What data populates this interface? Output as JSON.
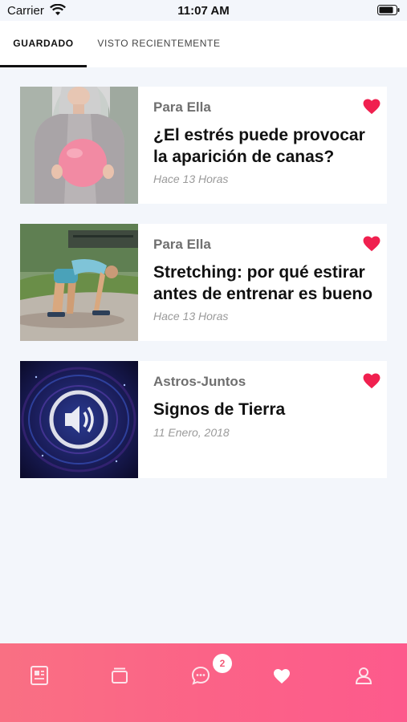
{
  "status_bar": {
    "carrier": "Carrier",
    "time": "11:07 AM"
  },
  "tabs": [
    {
      "label": "GUARDADO",
      "active": true
    },
    {
      "label": "VISTO RECIENTEMENTE",
      "active": false
    }
  ],
  "articles": [
    {
      "category": "Para Ella",
      "title": "¿El estrés puede provocar la aparición de canas?",
      "time": "Hace 13 Horas",
      "favorited": true
    },
    {
      "category": "Para Ella",
      "title": "Stretching: por qué estirar antes de entrenar es bueno",
      "time": "Hace 13 Horas",
      "favorited": true
    },
    {
      "category": "Astros-Juntos",
      "title": "Signos de Tierra",
      "time": "11 Enero, 2018",
      "favorited": true
    }
  ],
  "tabbar": {
    "items": [
      {
        "icon": "newspaper-icon"
      },
      {
        "icon": "cards-icon"
      },
      {
        "icon": "chat-icon",
        "badge": "2"
      },
      {
        "icon": "heart-icon",
        "active": true
      },
      {
        "icon": "user-icon"
      }
    ]
  },
  "colors": {
    "accent": "#f0204f",
    "tabbar_start": "#f97083",
    "tabbar_end": "#fd5a8c"
  }
}
